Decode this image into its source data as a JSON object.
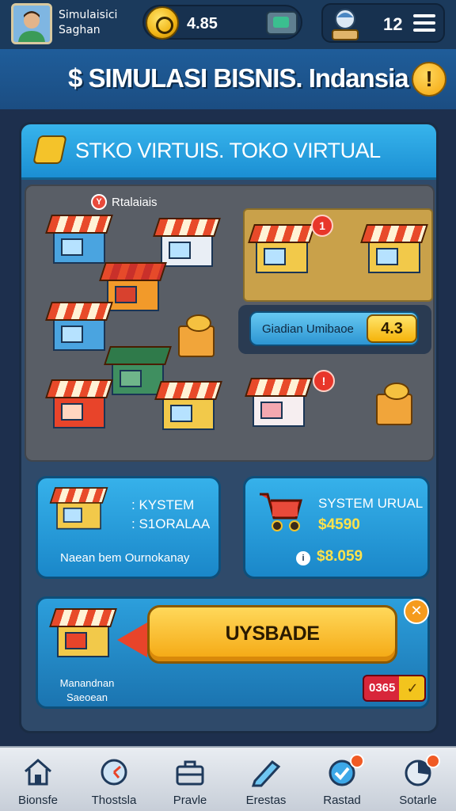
{
  "header": {
    "player_name_line1": "Simulaisici",
    "player_name_line2": "Saghan",
    "coins": "4.85",
    "level": "12"
  },
  "title": {
    "game_title": "$ SIMULASI BISNIS. Indansia",
    "help_label": "!"
  },
  "panel": {
    "title": "STKO VIRTUIS. TOKO VIRTUAL",
    "map_badge": "Y",
    "map_label": "Rtalaiais",
    "notif_1": "1",
    "notif_2": "!",
    "upgrade_chip_label": "Giadian Umibaoe",
    "upgrade_chip_value": "4.3"
  },
  "cards": {
    "left_line1": ": KYSTEM",
    "left_line2": ": S1ORALAA",
    "left_note": "Naean bem Ournokanay",
    "right_title": "SYSTEM URUAL",
    "right_price": "$4590",
    "right_coin_symbol": "i",
    "right_balance": "$8.059"
  },
  "upgrade": {
    "button_label": "UYSBADE",
    "close_label": "✕",
    "caption_line1": "Manandnan",
    "caption_line2": "Saeoean",
    "cost_value": "0365",
    "cost_check": "✓"
  },
  "nav": [
    {
      "label": "Bionsfe",
      "icon": "home-icon"
    },
    {
      "label": "Thostsla",
      "icon": "clock-icon"
    },
    {
      "label": "Pravle",
      "icon": "briefcase-icon"
    },
    {
      "label": "Erestas",
      "icon": "pencil-icon"
    },
    {
      "label": "Rastad",
      "icon": "checkmark-icon"
    },
    {
      "label": "Sotarle",
      "icon": "stats-icon"
    }
  ],
  "colors": {
    "background": "#1d2f4d",
    "panel_header": "#1b8fd3",
    "button_yellow": "#f4a711",
    "notif_red": "#e8362a",
    "price_yellow": "#ffe24a"
  }
}
